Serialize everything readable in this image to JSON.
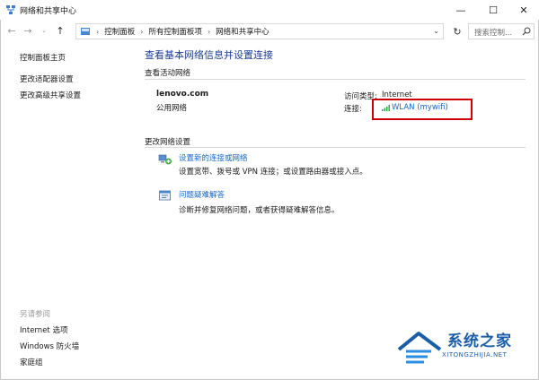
{
  "window": {
    "title": "网络和共享中心",
    "minimize_glyph": "—",
    "maximize_glyph": "☐",
    "close_glyph": "✕"
  },
  "address": {
    "breadcrumbs": [
      "控制面板",
      "所有控制面板项",
      "网络和共享中心"
    ],
    "search_placeholder": "搜索控制..."
  },
  "sidebar": {
    "links": [
      "控制面板主页",
      "更改适配器设置",
      "更改高级共享设置"
    ],
    "see_also_caption": "另请参阅",
    "see_also": [
      "Internet 选项",
      "Windows 防火墙",
      "家庭组"
    ]
  },
  "main": {
    "title": "查看基本网络信息并设置连接",
    "active_networks_heading": "查看活动网络",
    "network": {
      "name": "lenovo.com",
      "type": "公用网络",
      "access_type_label": "访问类型:",
      "access_type_value": "Internet",
      "connections_label": "连接:",
      "connection_link": "WLAN (mywifi)"
    },
    "change_settings_heading": "更改网络设置",
    "tasks": [
      {
        "link": "设置新的连接或网络",
        "description": "设置宽带、拨号或 VPN 连接；或设置路由器或接入点。",
        "icon": "new-connection-icon"
      },
      {
        "link": "问题疑难解答",
        "description": "诊断并修复网络问题，或者获得疑难解答信息。",
        "icon": "troubleshoot-icon"
      }
    ]
  },
  "watermark": {
    "text": "系统之家",
    "subtext": "XITONGZHIJIA.NET"
  },
  "colors": {
    "link": "#1466c6",
    "title": "#1b3c8e",
    "highlight": "#d10000"
  }
}
